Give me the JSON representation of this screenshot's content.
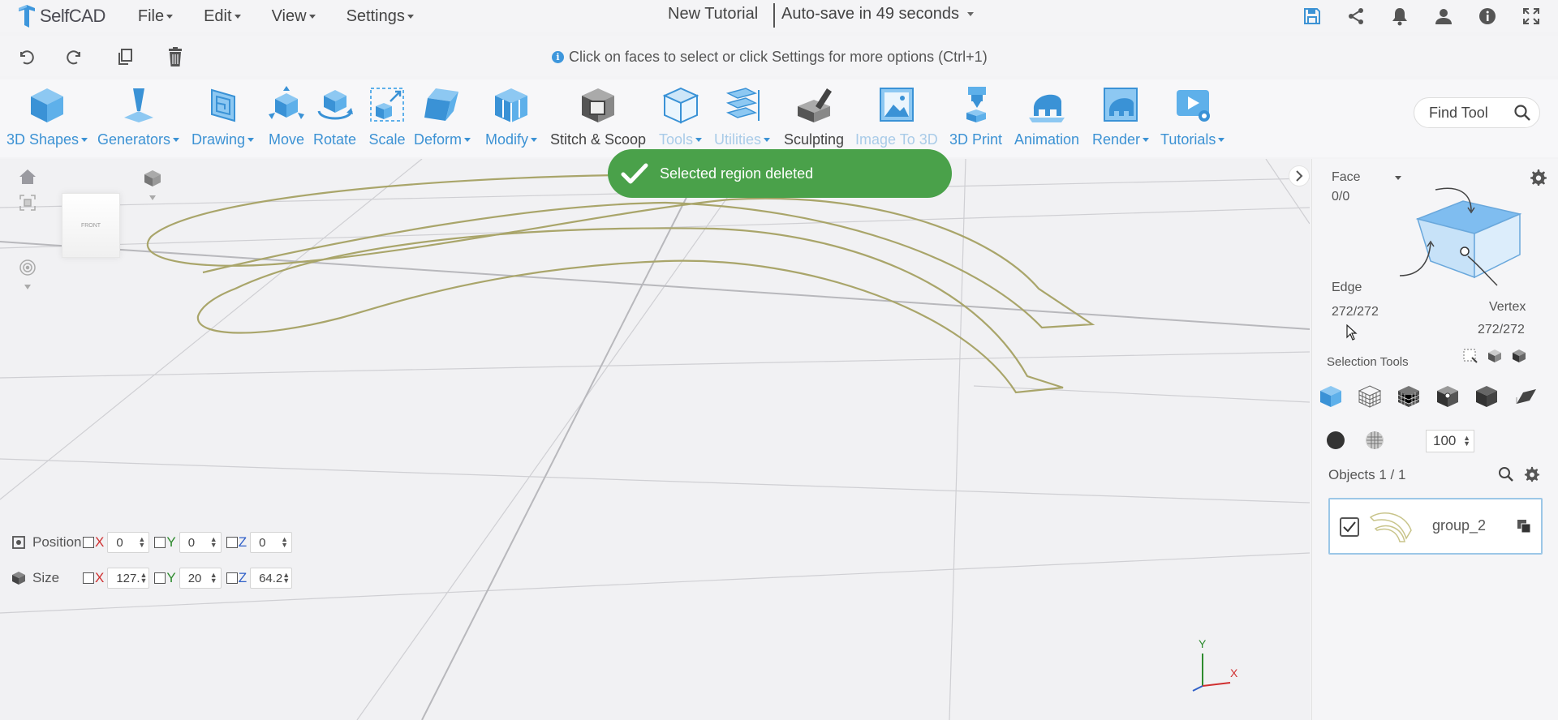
{
  "app": {
    "name": "SelfCAD",
    "menus": [
      "File",
      "Edit",
      "View",
      "Settings"
    ],
    "document_title": "New Tutorial",
    "autosave": "Auto-save in 49 seconds"
  },
  "top_icons": [
    "save-icon",
    "share-icon",
    "bell-icon",
    "user-icon",
    "info-icon",
    "fullscreen-icon"
  ],
  "action_row": {
    "hint": "Click on faces to select or click Settings for more options (Ctrl+1)",
    "icons": [
      "undo-icon",
      "redo-icon",
      "copy-icon",
      "trash-icon"
    ]
  },
  "toolbar": {
    "tools": [
      {
        "label": "3D Shapes",
        "dropdown": true,
        "style": "blue"
      },
      {
        "label": "Generators",
        "dropdown": true,
        "style": "blue"
      },
      {
        "label": "Drawing",
        "dropdown": true,
        "style": "blue"
      },
      {
        "label": "Move",
        "dropdown": false,
        "style": "blue"
      },
      {
        "label": "Rotate",
        "dropdown": false,
        "style": "blue"
      },
      {
        "label": "Scale",
        "dropdown": false,
        "style": "blue"
      },
      {
        "label": "Deform",
        "dropdown": true,
        "style": "blue"
      },
      {
        "label": "Modify",
        "dropdown": true,
        "style": "blue"
      },
      {
        "label": "Stitch & Scoop",
        "dropdown": false,
        "style": "dark"
      },
      {
        "label": "Tools",
        "dropdown": true,
        "style": "faded"
      },
      {
        "label": "Utilities",
        "dropdown": true,
        "style": "faded"
      },
      {
        "label": "Sculpting",
        "dropdown": false,
        "style": "dark"
      },
      {
        "label": "Image To 3D",
        "dropdown": false,
        "style": "faded"
      },
      {
        "label": "3D Print",
        "dropdown": false,
        "style": "blue"
      },
      {
        "label": "Animation",
        "dropdown": false,
        "style": "blue"
      },
      {
        "label": "Render",
        "dropdown": true,
        "style": "blue"
      },
      {
        "label": "Tutorials",
        "dropdown": true,
        "style": "blue"
      }
    ],
    "find_tool_placeholder": "Find Tool"
  },
  "toast": {
    "message": "Selected region deleted",
    "color": "#4aa14a"
  },
  "viewport": {
    "nav_cube_label": "FRONT",
    "axis_labels": {
      "y": "Y",
      "x": "X"
    }
  },
  "transform": {
    "position": {
      "label": "Position",
      "x": "0",
      "y": "0",
      "z": "0"
    },
    "size": {
      "label": "Size",
      "x": "127.",
      "y": "20",
      "z": "64.2"
    },
    "axis_names": {
      "x": "X",
      "y": "Y",
      "z": "Z"
    },
    "axis_colors": {
      "x": "#d03030",
      "y": "#2e8b2e",
      "z": "#3060c8"
    }
  },
  "right_panel": {
    "mode": "Face",
    "face_count": "0/0",
    "edge_label": "Edge",
    "edge_count": "272/272",
    "vertex_label": "Vertex",
    "vertex_count": "272/272",
    "selection_tools_label": "Selection Tools",
    "brush_size": "100",
    "objects_label": "Objects 1 / 1",
    "objects": [
      {
        "name": "group_2",
        "checked": true
      }
    ]
  },
  "colors": {
    "accent": "#3c92d4",
    "curve": "#a9a56a"
  }
}
